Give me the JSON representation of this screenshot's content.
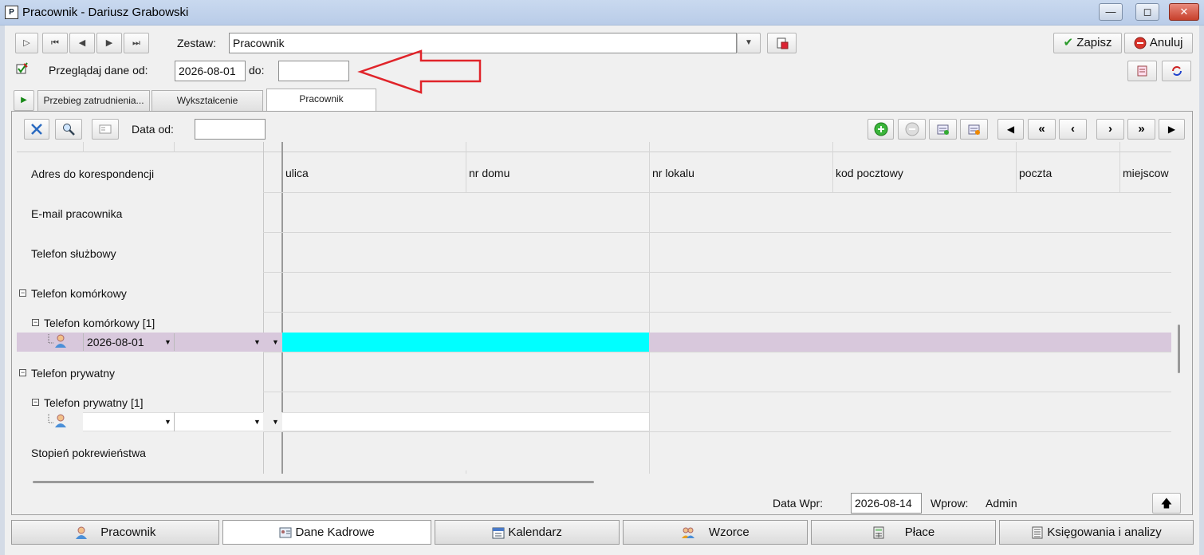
{
  "window": {
    "title": "Pracownik - Dariusz Grabowski"
  },
  "toolbar": {
    "zestaw_label": "Zestaw:",
    "zestaw_value": "Pracownik",
    "przegladaj_label": "Przeglądaj dane od:",
    "date_from": "2026-08-01",
    "do_label": "do:",
    "date_to": "",
    "save_label": "Zapisz",
    "cancel_label": "Anuluj"
  },
  "tabs": [
    {
      "label": "Przebieg zatrudnienia..."
    },
    {
      "label": "Wykształcenie"
    },
    {
      "label": "Pracownik"
    }
  ],
  "grid_toolbar": {
    "data_od_label": "Data od:",
    "data_od_value": ""
  },
  "grid": {
    "columns": [
      "ulica",
      "nr domu",
      "nr lokalu",
      "kod pocztowy",
      "poczta",
      "miejscow"
    ],
    "rows": [
      {
        "label": "Adres do korespondencji"
      },
      {
        "label": "E-mail pracownika"
      },
      {
        "label": "Telefon służbowy"
      },
      {
        "label": "Telefon komórkowy"
      },
      {
        "label": "Telefon komórkowy [1]"
      },
      {
        "date": "2026-08-01"
      },
      {
        "label": "Telefon prywatny"
      },
      {
        "label": "Telefon prywatny [1]"
      },
      {
        "label": ""
      },
      {
        "label": "Stopień pokrewieństwa"
      }
    ],
    "selected_cell_color": "#00ffff",
    "selected_row_color": "#d8c8dc"
  },
  "footer": {
    "data_wpr_label": "Data Wpr:",
    "data_wpr_value": "2026-08-14",
    "wprow_label": "Wprow:",
    "wprow_value": "Admin"
  },
  "bottom_tabs": [
    {
      "label": "Pracownik"
    },
    {
      "label": "Dane Kadrowe"
    },
    {
      "label": "Kalendarz"
    },
    {
      "label": "Wzorce"
    },
    {
      "label": "Płace"
    },
    {
      "label": "Księgowania i analizy"
    }
  ],
  "colors": {
    "accent_arrow": "#e0242a",
    "titlebar": "#c4d5ee"
  }
}
